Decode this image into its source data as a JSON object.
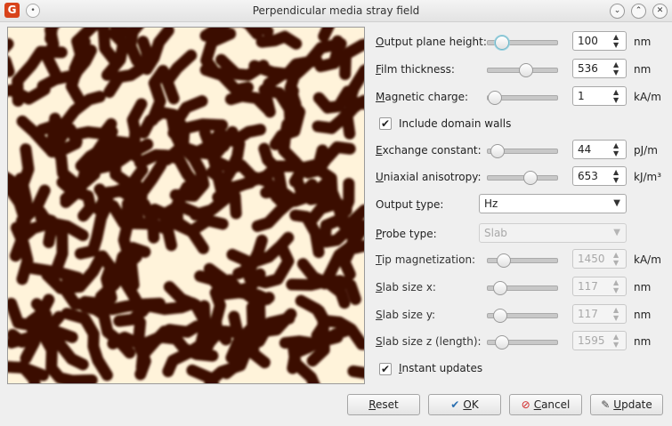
{
  "window": {
    "title": "Perpendicular media stray field"
  },
  "fields": [
    {
      "id": "output-plane-height",
      "label_u": "O",
      "label_rest": "utput plane height:",
      "value": "100",
      "unit": "nm",
      "slider": 0.12,
      "disabled": false,
      "focus": true
    },
    {
      "id": "film-thickness",
      "label_u": "F",
      "label_rest": "ilm thickness:",
      "value": "536",
      "unit": "nm",
      "slider": 0.54,
      "disabled": false,
      "focus": false
    },
    {
      "id": "magnetic-charge",
      "label_u": "M",
      "label_rest": "agnetic charge:",
      "value": "1",
      "unit": "kA/m",
      "slider": 0.0,
      "disabled": false,
      "focus": false
    },
    {
      "id": "exchange-constant",
      "label_u": "E",
      "label_rest": "xchange constant:",
      "value": "44",
      "unit": "pJ/m",
      "slider": 0.05,
      "disabled": false,
      "focus": false
    },
    {
      "id": "uniaxial-anisotropy",
      "label_u": "U",
      "label_rest": "niaxial anisotropy:",
      "value": "653",
      "unit": "kJ/m³",
      "slider": 0.62,
      "disabled": false,
      "focus": false
    },
    {
      "id": "tip-magnetization",
      "label_u": "T",
      "label_rest": "ip magnetization:",
      "value": "1450",
      "unit": "kA/m",
      "slider": 0.15,
      "disabled": true,
      "focus": false
    },
    {
      "id": "slab-size-x",
      "label_u": "S",
      "label_rest": "lab size x:",
      "value": "117",
      "unit": "nm",
      "slider": 0.1,
      "disabled": true,
      "focus": false
    },
    {
      "id": "slab-size-y",
      "label_u": "S",
      "label_rest": "lab size y:",
      "value": "117",
      "unit": "nm",
      "slider": 0.1,
      "disabled": true,
      "focus": false
    },
    {
      "id": "slab-size-z",
      "label_u": "S",
      "label_rest": "lab size z (length):",
      "value": "1595",
      "unit": "nm",
      "slider": 0.12,
      "disabled": true,
      "focus": false
    }
  ],
  "include_domain_walls": {
    "label": "Include domain walls",
    "checked": true
  },
  "output_type": {
    "label_pre": "Output ",
    "label_u": "t",
    "label_rest": "ype:",
    "value": "Hz"
  },
  "probe_type": {
    "label_u": "P",
    "label_rest": "robe type:",
    "value": "Slab"
  },
  "instant_updates": {
    "label_u": "I",
    "label_rest": "nstant updates",
    "checked": true
  },
  "buttons": {
    "reset": {
      "u": "R",
      "rest": "eset"
    },
    "ok": {
      "u": "O",
      "rest": "K"
    },
    "cancel": {
      "u": "C",
      "rest": "ancel"
    },
    "update": {
      "u": "U",
      "rest": "pdate"
    }
  },
  "colors": {
    "domain_dark": "#3b0b00",
    "domain_light": "#fff3da",
    "accent": "#6fb7c9"
  },
  "icons": [
    "app-logo-icon",
    "window-menu-icon",
    "minimize-icon",
    "maximize-icon",
    "close-icon",
    "checkmark-icon",
    "ok-check-icon",
    "cancel-stop-icon",
    "update-brush-icon"
  ]
}
